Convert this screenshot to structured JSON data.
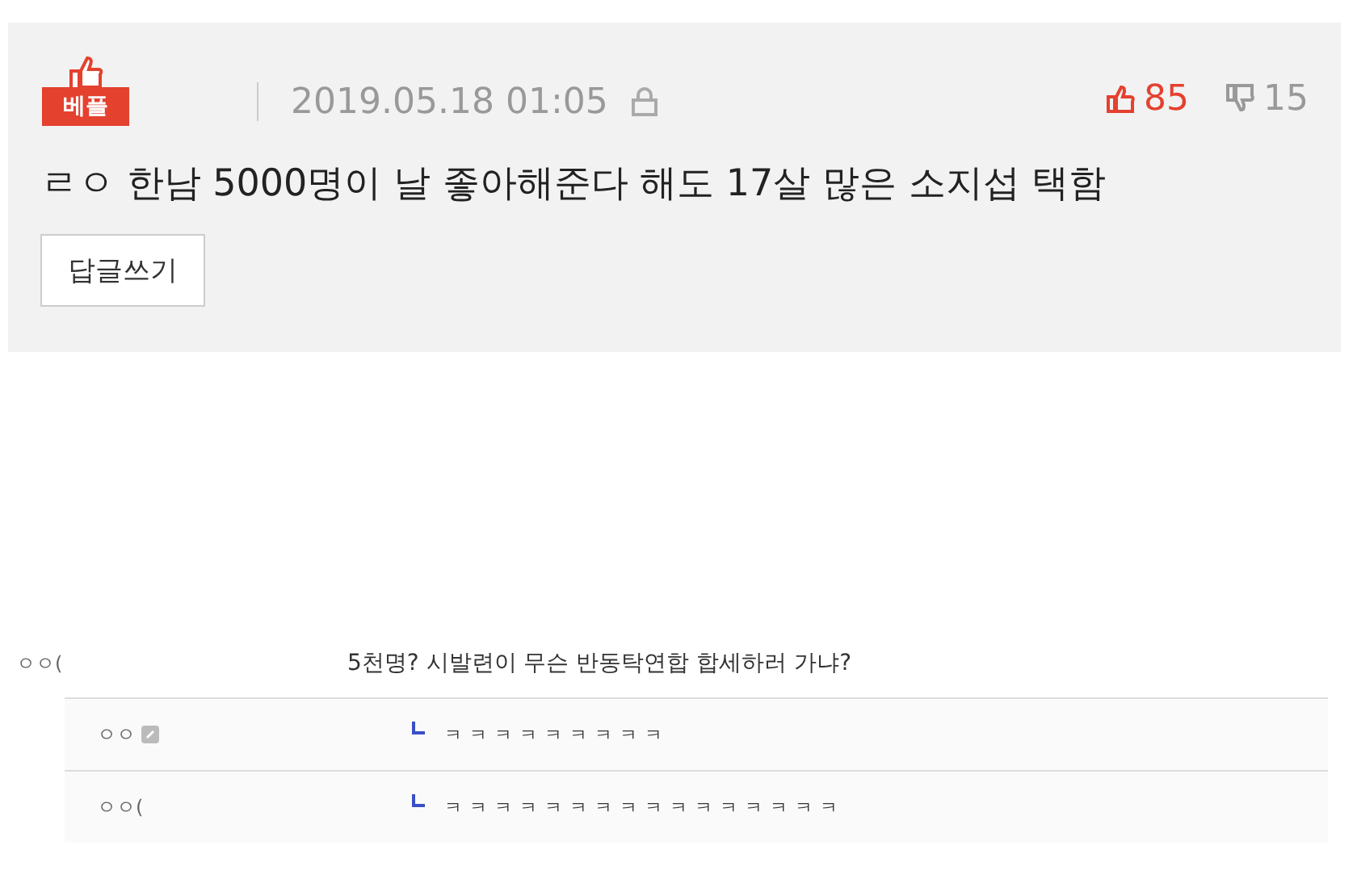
{
  "post": {
    "badge": "베플",
    "date": "2019.05.18 01:05",
    "likes": "85",
    "dislikes": "15",
    "title": "ㄹㅇ 한남 5000명이 날 좋아해준다 해도 17살 많은 소지섭 택함",
    "reply_button": "답글쓰기"
  },
  "comment": {
    "author": "ㅇㅇ(",
    "text": "5천명? 시발련이 무슨 반동탁연합 합세하러 가냐?"
  },
  "replies": [
    {
      "author": "ㅇㅇ",
      "kind": "member",
      "text": "ㅋㅋㅋㅋㅋㅋㅋㅋㅋ"
    },
    {
      "author": "ㅇㅇ(",
      "kind": "guest",
      "text": "ㅋㅋㅋㅋㅋㅋㅋㅋㅋㅋㅋㅋㅋㅋㅋㅋ"
    }
  ]
}
